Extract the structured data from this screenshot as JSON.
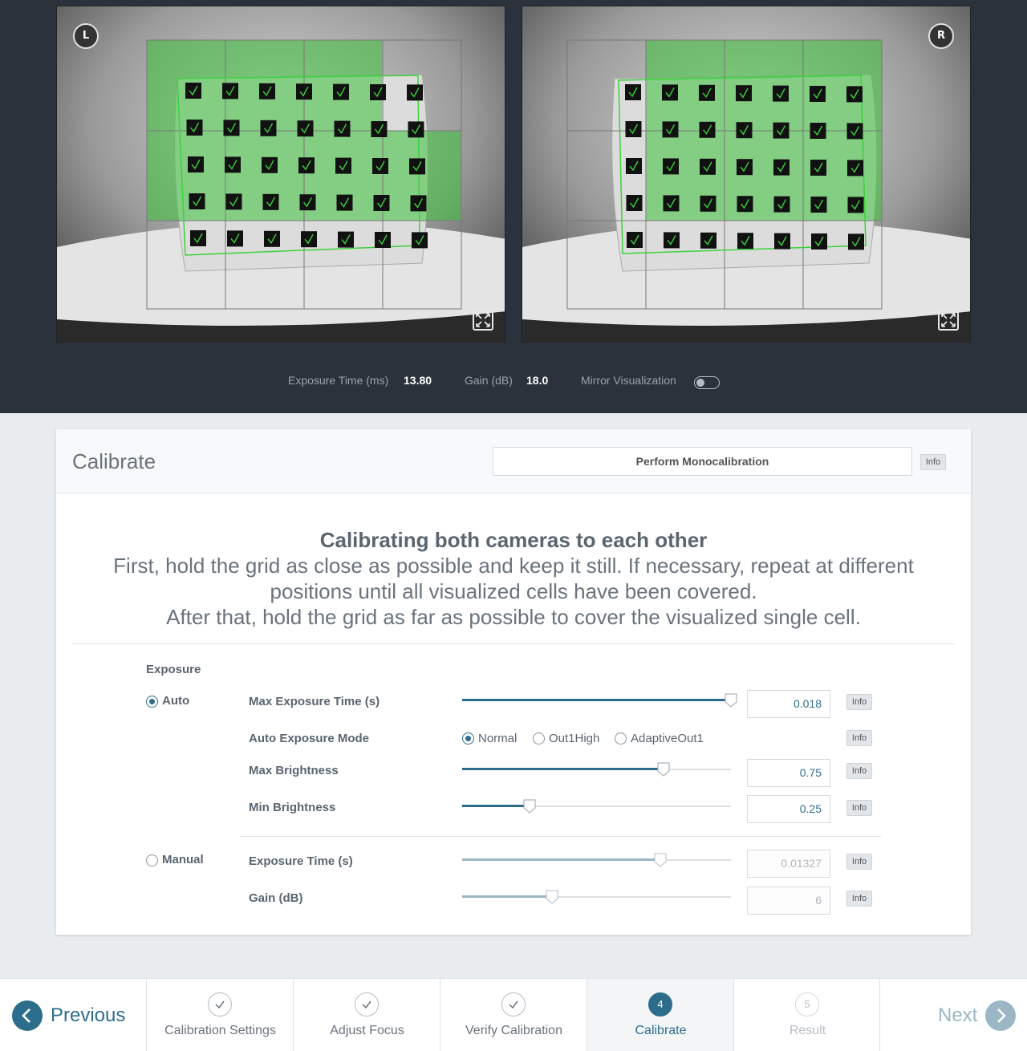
{
  "cameras": {
    "left": {
      "badge": "L"
    },
    "right": {
      "badge": "R"
    }
  },
  "camera_info": {
    "exposure_label": "Exposure Time (ms)",
    "exposure_value": "13.80",
    "gain_label": "Gain (dB)",
    "gain_value": "18.0",
    "mirror_label": "Mirror Visualization",
    "mirror_on": false
  },
  "panel": {
    "title": "Calibrate",
    "mono_button": "Perform Monocalibration",
    "info": "Info"
  },
  "instructions": {
    "heading": "Calibrating both cameras to each other",
    "line1": "First, hold the grid as close as possible and keep it still. If necessary, repeat at different",
    "line2": "positions until all visualized cells have been covered.",
    "line3": "After that, hold the grid as far as possible to cover the visualized single cell."
  },
  "exposure": {
    "section_label": "Exposure",
    "auto_label": "Auto",
    "manual_label": "Manual",
    "auto_selected": true,
    "fields": {
      "max_exposure": {
        "label": "Max Exposure Time (s)",
        "value": "0.018",
        "fraction": 1.0
      },
      "auto_mode": {
        "label": "Auto Exposure Mode",
        "options": [
          "Normal",
          "Out1High",
          "AdaptiveOut1"
        ],
        "selected": "Normal"
      },
      "max_brightness": {
        "label": "Max Brightness",
        "value": "0.75",
        "fraction": 0.75
      },
      "min_brightness": {
        "label": "Min Brightness",
        "value": "0.25",
        "fraction": 0.25
      },
      "exposure_time": {
        "label": "Exposure Time (s)",
        "value": "0.01327",
        "fraction": 0.737
      },
      "gain": {
        "label": "Gain (dB)",
        "value": "6",
        "fraction": 0.333
      }
    }
  },
  "wizard": {
    "previous": "Previous",
    "next": "Next",
    "steps": [
      {
        "label": "Calibration Settings",
        "number": "1",
        "state": "done"
      },
      {
        "label": "Adjust Focus",
        "number": "2",
        "state": "done"
      },
      {
        "label": "Verify Calibration",
        "number": "3",
        "state": "done"
      },
      {
        "label": "Calibrate",
        "number": "4",
        "state": "active"
      },
      {
        "label": "Result",
        "number": "5",
        "state": "disabled"
      }
    ]
  },
  "colors": {
    "accent": "#2d6d8c",
    "accent_disabled": "#9bb7c6",
    "overlay_green": "#7ad17a"
  }
}
